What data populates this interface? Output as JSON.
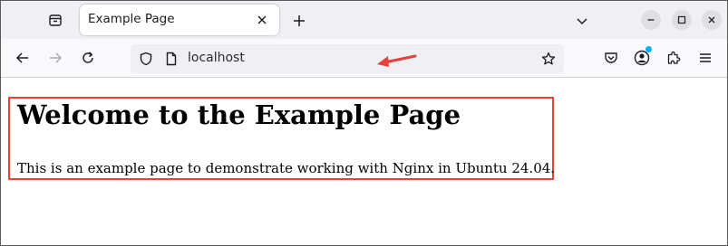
{
  "tab": {
    "title": "Example Page"
  },
  "urlbar": {
    "url": "localhost"
  },
  "content": {
    "heading": "Welcome to the Example Page",
    "paragraph": "This is an example page to demonstrate working with Nginx in Ubuntu 24.04."
  },
  "colors": {
    "annotation": "#e8413c",
    "extension_badge": "#00b3f4"
  },
  "icons": {
    "tab_list": "tab-list-icon",
    "tab_close": "close-icon",
    "new_tab": "plus-icon",
    "list_all_tabs": "chevron-down-icon",
    "back": "arrow-left-icon",
    "forward": "arrow-right-icon",
    "reload": "reload-icon",
    "tracking_protection": "shield-icon",
    "page_info": "page-icon",
    "bookmark": "star-icon",
    "pocket": "pocket-icon",
    "account": "account-icon",
    "extensions": "puzzle-icon",
    "menu": "hamburger-menu-icon"
  }
}
